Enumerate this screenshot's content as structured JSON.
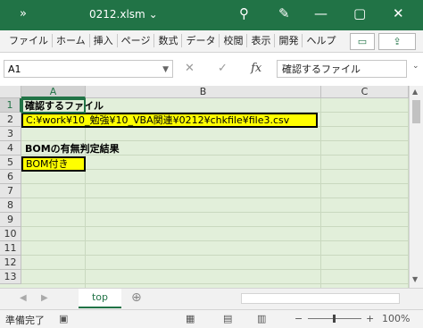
{
  "titlebar": {
    "qat_icon": "»",
    "filename": "0212.xlsm",
    "dropdown_icon": "⌄",
    "search_icon": "⚲",
    "brush_icon": "✎",
    "minimize_icon": "—",
    "restore_icon": "▢",
    "close_icon": "✕"
  },
  "ribbon": {
    "tabs": [
      "ファイル",
      "ホーム",
      "挿入",
      "ページ",
      "数式",
      "データ",
      "校閲",
      "表示",
      "開発",
      "ヘルプ"
    ],
    "comment_icon": "▭",
    "share_icon": "⇪"
  },
  "formula_bar": {
    "name_box": "A1",
    "cancel_icon": "✕",
    "enter_icon": "✓",
    "fx_label": "fx",
    "content": "確認するファイル",
    "expand_icon": "⌄"
  },
  "grid": {
    "columns": [
      "A",
      "B",
      "C"
    ],
    "rows": [
      "1",
      "2",
      "3",
      "4",
      "5",
      "6",
      "7",
      "8",
      "9",
      "10",
      "11",
      "12",
      "13"
    ],
    "cells": {
      "A1": "確認するファイル",
      "A2": "C:¥work¥10_勉強¥10_VBA関連¥0212¥chkfile¥file3.csv",
      "A4": "BOMの有無判定結果",
      "A5": "BOM付き"
    },
    "accent": "#217346",
    "highlight": "#ffff00",
    "sheet_bg": "#e2efda"
  },
  "sheets": {
    "prev_icon": "◀",
    "next_icon": "▶",
    "active": "top",
    "add_icon": "⊕"
  },
  "status": {
    "ready": "準備完了",
    "zoom": "100%",
    "zoom_minus": "−",
    "zoom_plus": "+"
  }
}
